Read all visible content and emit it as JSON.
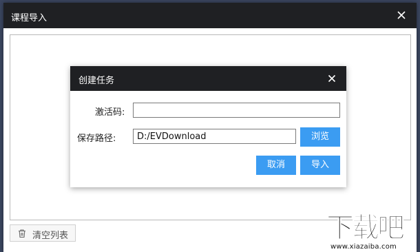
{
  "outer_window": {
    "title": "课程导入",
    "close_icon": "close-icon",
    "clear_list_label": "清空列表",
    "clear_list_icon": "trash-icon"
  },
  "dialog": {
    "title": "创建任务",
    "close_icon": "close-icon",
    "activation_label": "激活码:",
    "activation_value": "",
    "path_label": "保存路径:",
    "path_value": "D:/EVDownload",
    "browse_label": "浏览",
    "cancel_label": "取消",
    "import_label": "导入"
  },
  "watermark": {
    "logo_text": "下载吧",
    "url": "www.xiazaiba.com"
  },
  "colors": {
    "titlebar": "#1f2023",
    "accent_button": "#3b9cf2",
    "background": "#3b4660"
  }
}
